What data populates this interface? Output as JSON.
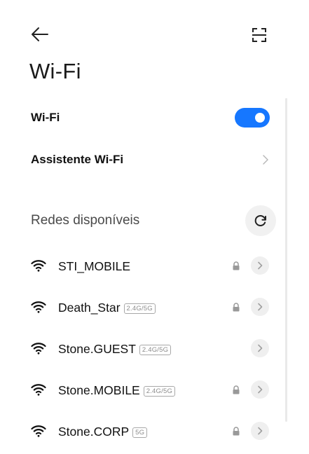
{
  "header": {
    "title": "Wi-Fi",
    "back_icon": "arrow-left-icon",
    "scan_icon": "qr-scan-icon"
  },
  "wifi_toggle": {
    "label": "Wi-Fi",
    "state": "on",
    "color": "#1677ff"
  },
  "assistant": {
    "label": "Assistente Wi-Fi",
    "icon": "chevron-right-icon"
  },
  "available": {
    "title": "Redes disponíveis",
    "refresh_icon": "refresh-icon"
  },
  "networks": [
    {
      "name": "STI_MOBILE",
      "band": "",
      "locked": true
    },
    {
      "name": "Death_Star",
      "band": "2.4G/5G",
      "locked": true
    },
    {
      "name": "Stone.GUEST",
      "band": "2.4G/5G",
      "locked": false
    },
    {
      "name": "Stone.MOBILE",
      "band": "2.4G/5G",
      "locked": true
    },
    {
      "name": "Stone.CORP",
      "band": "5G",
      "locked": true
    }
  ]
}
